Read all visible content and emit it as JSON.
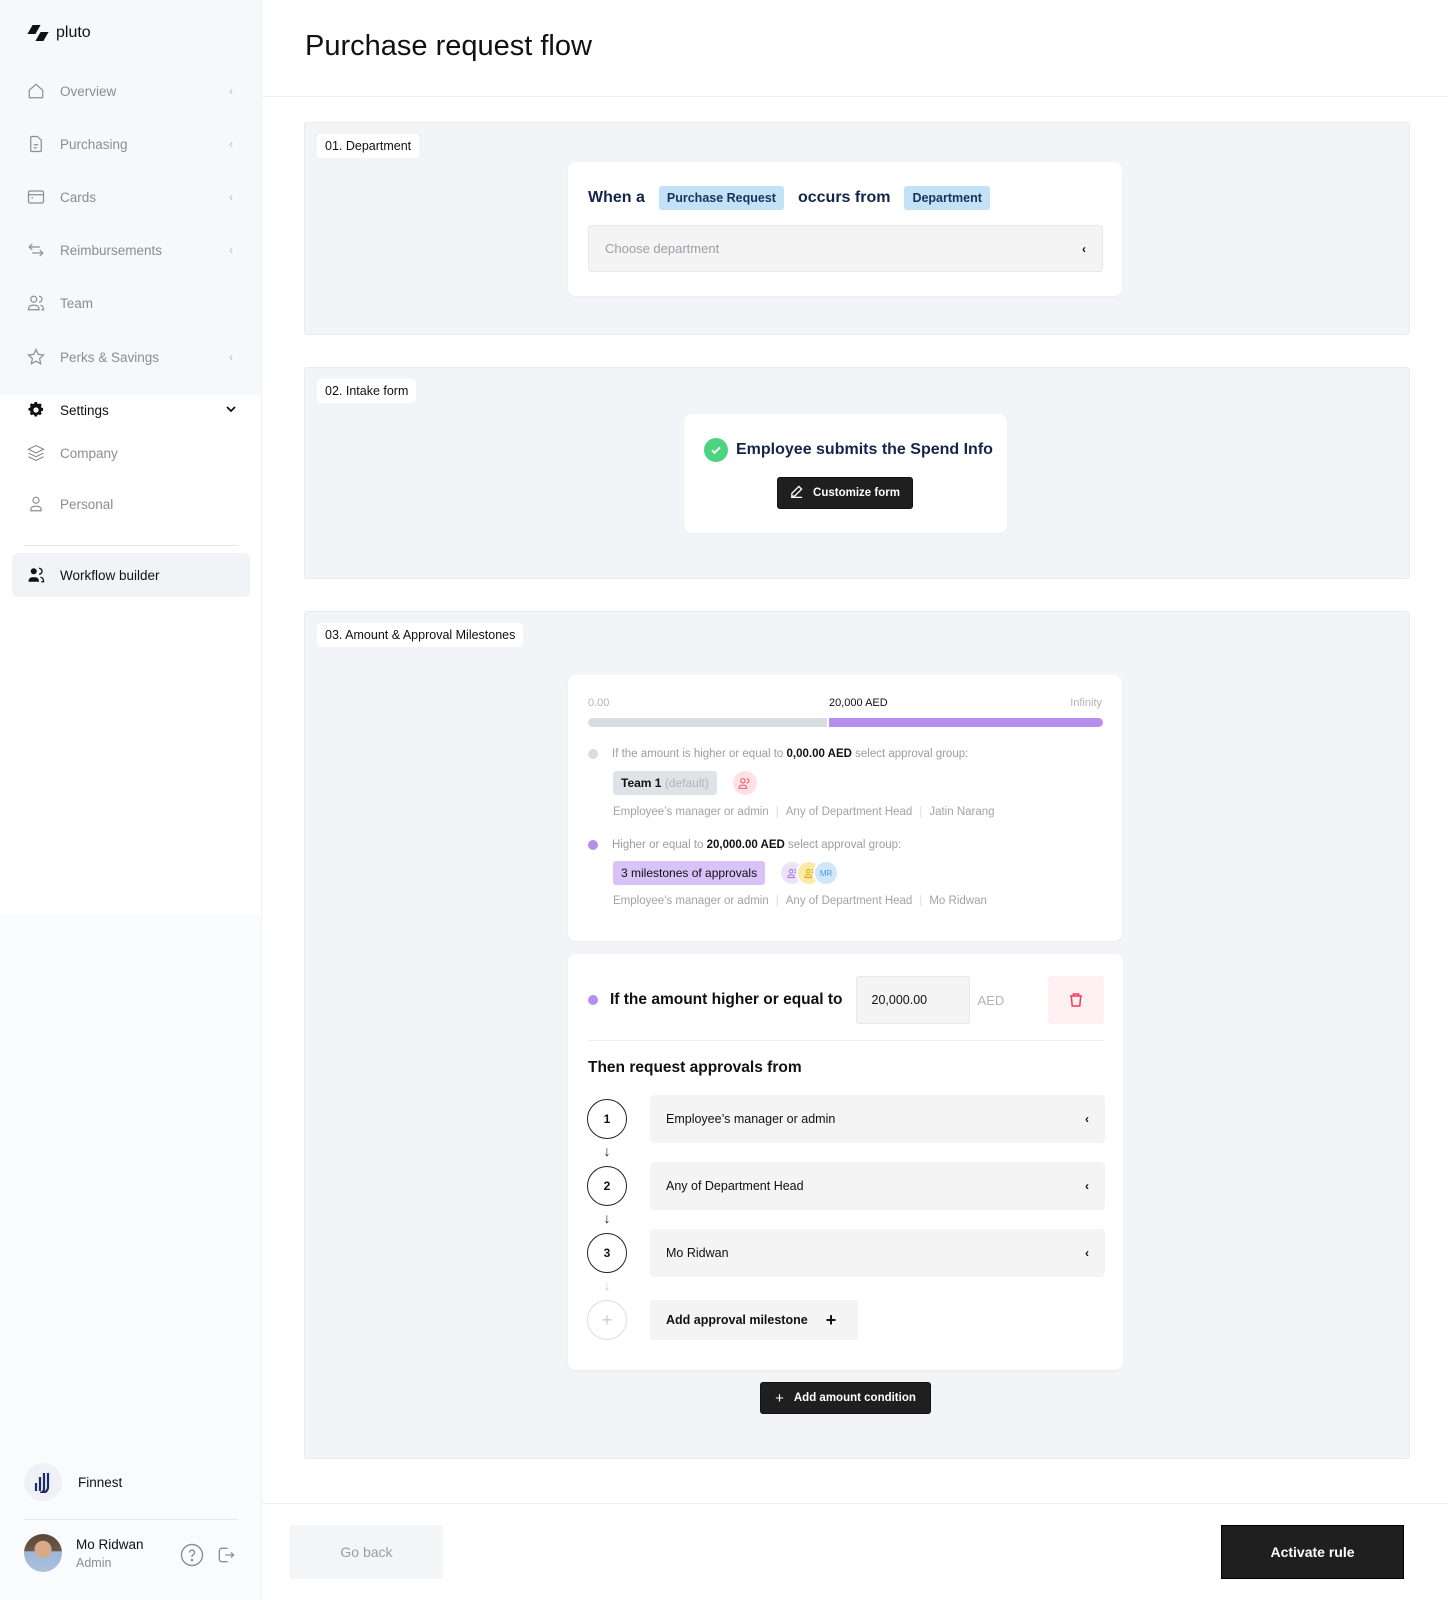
{
  "app": {
    "brand": "pluto",
    "page_title": "Purchase request flow"
  },
  "sidebar": {
    "items": [
      {
        "label": "Overview",
        "icon": "home-icon",
        "chevron": "‹"
      },
      {
        "label": "Purchasing",
        "icon": "document-icon",
        "chevron": "‹"
      },
      {
        "label": "Cards",
        "icon": "card-icon",
        "chevron": "‹"
      },
      {
        "label": "Reimbursements",
        "icon": "arrows-swap-icon",
        "chevron": "‹"
      },
      {
        "label": "Team",
        "icon": "users-icon",
        "chevron": ""
      },
      {
        "label": "Perks & Savings",
        "icon": "star-icon",
        "chevron": "‹"
      }
    ],
    "settings": {
      "label": "Settings",
      "icon": "gear-icon",
      "chevron": "⌄",
      "children": [
        {
          "label": "Company",
          "icon": "layers-icon"
        },
        {
          "label": "Personal",
          "icon": "user-icon"
        }
      ]
    },
    "active_item": {
      "label": "Workflow builder",
      "icon": "users-filled-icon"
    },
    "organization": {
      "name": "Finnest"
    },
    "user": {
      "name": "Mo Ridwan",
      "role": "Admin"
    }
  },
  "sections": {
    "department": {
      "tag": "01. Department",
      "when_text": "When a",
      "trigger_chip": "Purchase Request",
      "occurs_text": "occurs from",
      "source_chip": "Department",
      "select_placeholder": "Choose department",
      "select_chevron": "‹"
    },
    "intake": {
      "tag": "02. Intake form",
      "title": "Employee submits the Spend Info",
      "button_label": "Customize form"
    },
    "milestones": {
      "tag": "03. Amount & Approval Milestones",
      "range": {
        "min_label": "0.00",
        "mid_label": "20,000 AED",
        "max_label": "Infinity",
        "split_fraction": 0.465,
        "colors": {
          "low": "#d8dce3",
          "high": "#b58ef0"
        }
      },
      "rules": [
        {
          "prefix": "If the amount is higher or equal to",
          "amount": "0,00.00 AED",
          "suffix": "select approval group:",
          "group_label": "Team 1",
          "group_note": "(default)",
          "dot_color": "#d8dce3",
          "avatars": [
            {
              "icon": "user-group-icon",
              "bg": "#fde1e4",
              "fg": "#ef5b6e"
            }
          ],
          "approvers": [
            "Employee’s manager or admin",
            "Any of Department Head",
            "Jatin Narang"
          ]
        },
        {
          "prefix": "Higher or equal to",
          "amount": "20,000.00 AED",
          "suffix": "select approval group:",
          "group_label": "3 milestones of approvals",
          "dot_color": "#b58ef0",
          "avatars": [
            {
              "icon": "user-group-icon",
              "bg": "#ece3fb",
              "fg": "#9b6ee6"
            },
            {
              "icon": "user-group-icon",
              "bg": "#fde9a8",
              "fg": "#e0a400"
            },
            {
              "initials": "MR",
              "bg": "#cfe6fb",
              "fg": "#4a9ae0"
            }
          ],
          "approvers": [
            "Employee’s manager or admin",
            "Any of Department Head",
            "Mo Ridwan"
          ]
        }
      ],
      "condition": {
        "label": "If the amount higher or equal to",
        "amount_value": "20,000.00",
        "currency": "AED",
        "then_title": "Then request approvals from",
        "steps": [
          {
            "number": "1",
            "value": "Employee’s manager or admin"
          },
          {
            "number": "2",
            "value": "Any of Department Head"
          },
          {
            "number": "3",
            "value": "Mo Ridwan"
          }
        ],
        "add_milestone_label": "Add approval milestone"
      },
      "add_condition_label": "Add amount condition"
    }
  },
  "footer": {
    "go_back_label": "Go back",
    "activate_label": "Activate rule"
  }
}
